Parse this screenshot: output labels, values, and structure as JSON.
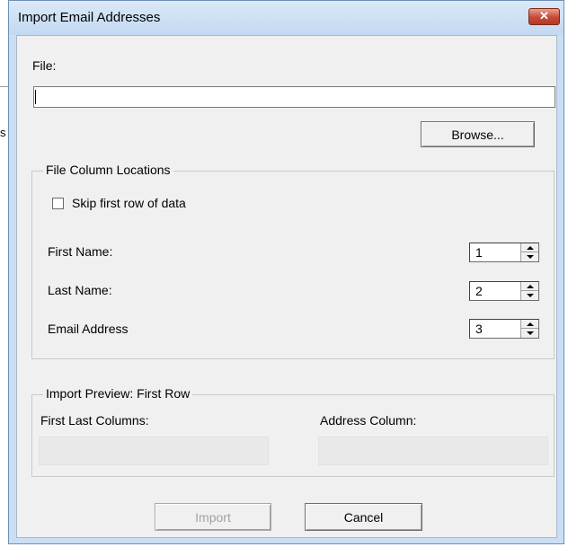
{
  "background_fragments": {
    "s_char": "s"
  },
  "window": {
    "title": "Import Email Addresses",
    "close_glyph": "✕",
    "colors": {
      "title_bar": "#c9dff5",
      "close_button": "#c64a35",
      "dialog_face": "#f0f0f0"
    }
  },
  "file": {
    "label": "File:",
    "value": "",
    "browse_label": "Browse..."
  },
  "column_locations": {
    "title": "File Column Locations",
    "skip_first_row_label": "Skip first row of data",
    "skip_first_row_checked": false,
    "first_name_label": "First Name:",
    "first_name_value": "1",
    "last_name_label": "Last Name:",
    "last_name_value": "2",
    "email_label": "Email Address",
    "email_value": "3"
  },
  "preview": {
    "title": "Import Preview: First Row",
    "first_last_label": "First Last Columns:",
    "first_last_value": "",
    "address_label": "Address Column:",
    "address_value": ""
  },
  "buttons": {
    "import_label": "Import",
    "import_enabled": false,
    "cancel_label": "Cancel"
  },
  "icons": {
    "close": "close-icon",
    "spin_up": "arrow-up-icon",
    "spin_down": "arrow-down-icon"
  }
}
